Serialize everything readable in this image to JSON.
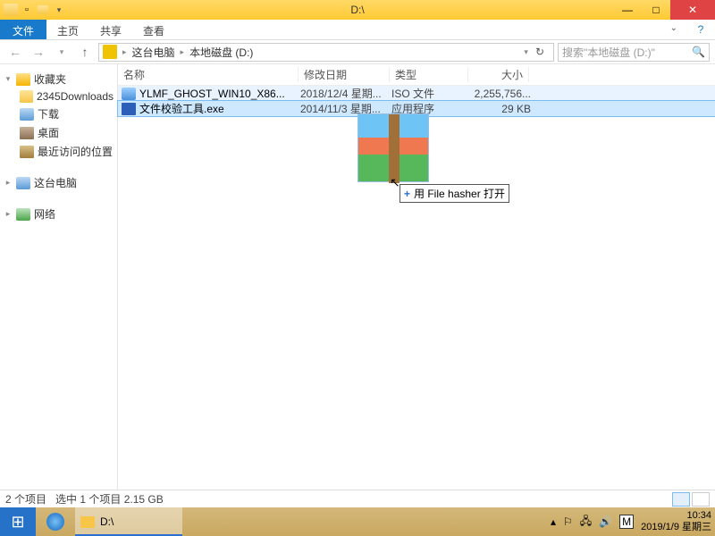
{
  "window": {
    "title": "D:\\"
  },
  "ribbon": {
    "file": "文件",
    "tabs": [
      "主页",
      "共享",
      "查看"
    ]
  },
  "nav": {
    "crumbs": [
      "这台电脑",
      "本地磁盘 (D:)"
    ],
    "search_placeholder": "搜索\"本地磁盘 (D:)\""
  },
  "sidebar": {
    "fav_label": "收藏夹",
    "fav_items": [
      "2345Downloads",
      "下载",
      "桌面",
      "最近访问的位置"
    ],
    "pc_label": "这台电脑",
    "net_label": "网络"
  },
  "columns": {
    "name": "名称",
    "date": "修改日期",
    "type": "类型",
    "size": "大小"
  },
  "rows": [
    {
      "name": "YLMF_GHOST_WIN10_X86...",
      "date": "2018/12/4 星期...",
      "type": "ISO 文件",
      "size": "2,255,756..."
    },
    {
      "name": "文件校验工具.exe",
      "date": "2014/11/3 星期...",
      "type": "应用程序",
      "size": "29 KB"
    }
  ],
  "drag_tip": "用 File hasher 打开",
  "status": {
    "count": "2 个项目",
    "sel": "选中 1 个项目 2.15 GB"
  },
  "taskbar": {
    "active_label": "D:\\"
  },
  "tray": {
    "ime": "M",
    "time": "10:34",
    "date": "2019/1/9 星期三"
  }
}
